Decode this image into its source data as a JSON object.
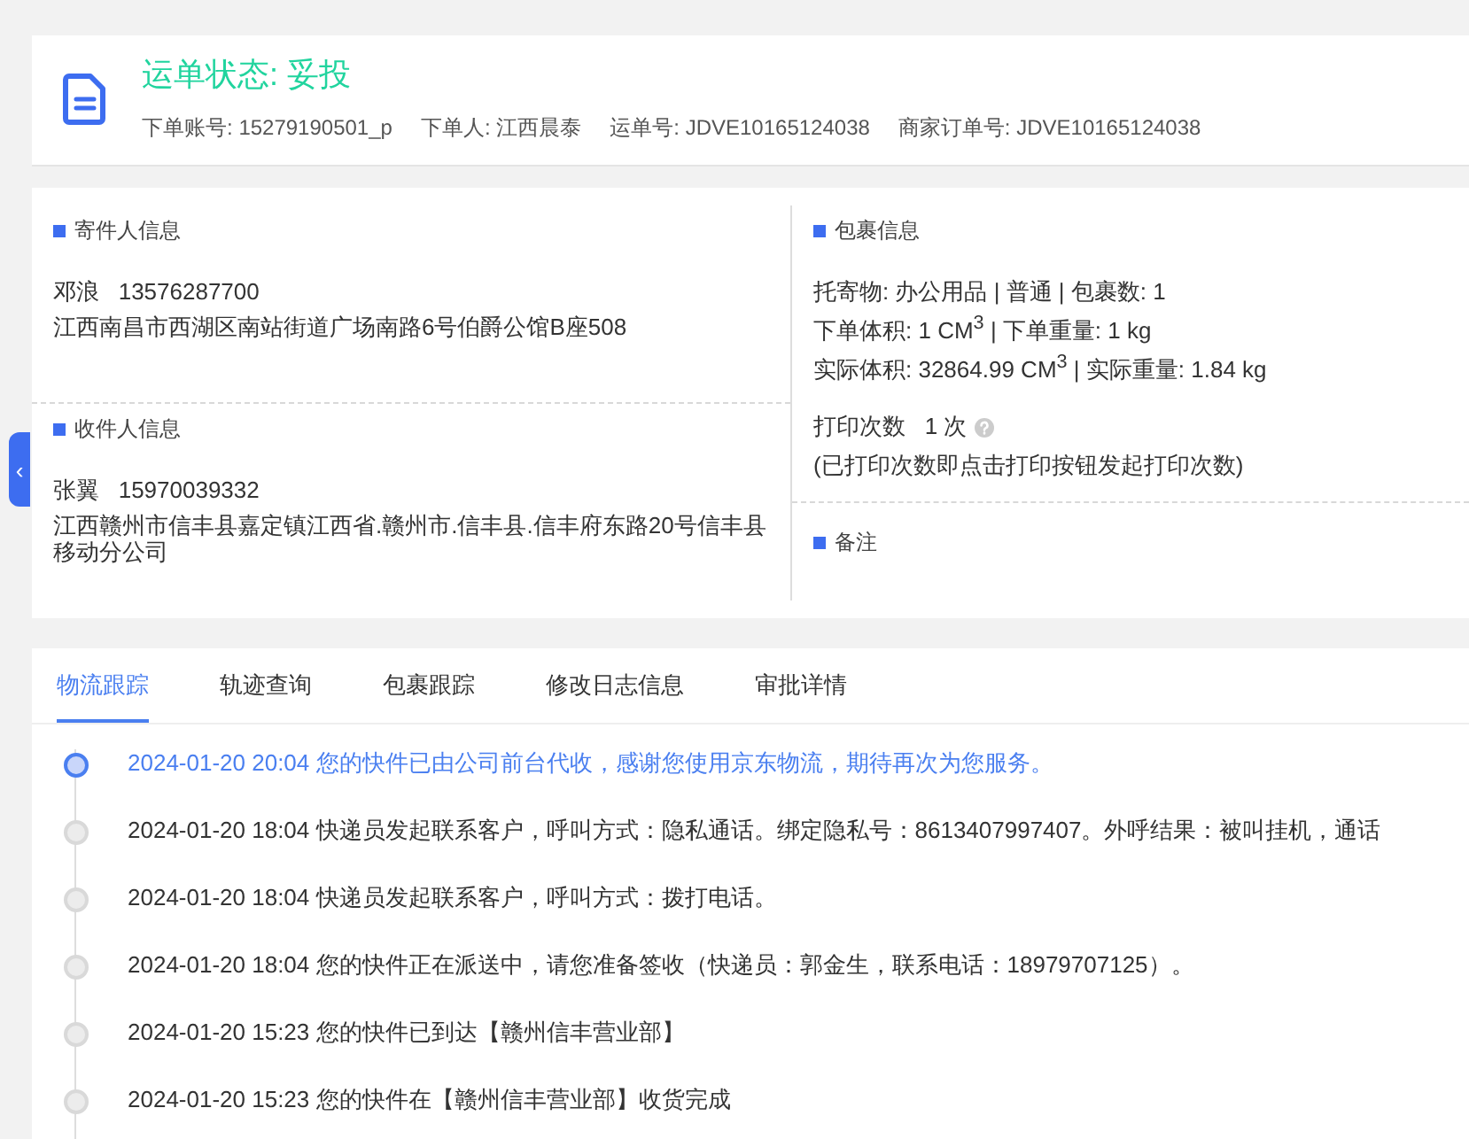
{
  "header": {
    "status": "运单状态: 妥投",
    "meta": [
      {
        "label": "下单账号:",
        "value": "15279190501_p"
      },
      {
        "label": "下单人:",
        "value": "江西晨泰"
      },
      {
        "label": "运单号:",
        "value": "JDVE10165124038"
      },
      {
        "label": "商家订单号:",
        "value": "JDVE10165124038"
      }
    ]
  },
  "sender": {
    "title": "寄件人信息",
    "name": "邓浪",
    "phone": "13576287700",
    "address": "江西南昌市西湖区南站街道广场南路6号伯爵公馆B座508"
  },
  "receiver": {
    "title": "收件人信息",
    "name": "张翼",
    "phone": "15970039332",
    "address": "江西赣州市信丰县嘉定镇江西省.赣州市.信丰县.信丰府东路20号信丰县移动分公司"
  },
  "package": {
    "title": "包裹信息",
    "lines": [
      "托寄物:  办公用品 | 普通  |  包裹数:  1",
      "下单体积:   1 CM$^{3}$ |  下单重量:  1 kg",
      "实际体积:   32864.99 CM$^{3}$ |  实际重量:  1.84 kg"
    ],
    "print_label": "打印次数",
    "print_count": "1 次",
    "print_note": "(已打印次数即点击打印按钮发起打印次数)"
  },
  "remarks": {
    "title": "备注"
  },
  "side_toggle": {
    "glyph": "‹"
  },
  "tabs": [
    {
      "label": "物流跟踪",
      "selected": true
    },
    {
      "label": "轨迹查询",
      "selected": false
    },
    {
      "label": "包裹跟踪",
      "selected": false
    },
    {
      "label": "修改日志信息",
      "selected": false
    },
    {
      "label": "审批详情",
      "selected": false
    }
  ],
  "timeline": [
    {
      "text": "2024-01-20 20:04 您的快件已由公司前台代收，感谢您使用京东物流，期待再次为您服务。",
      "current": true
    },
    {
      "text": "2024-01-20 18:04 快递员发起联系客户，呼叫方式：隐私通话。绑定隐私号：8613407997407。外呼结果：被叫挂机，通话",
      "current": false
    },
    {
      "text": "2024-01-20 18:04 快递员发起联系客户，呼叫方式：拨打电话。",
      "current": false
    },
    {
      "text": "2024-01-20 18:04 您的快件正在派送中，请您准备签收（快递员：郭金生，联系电话：18979707125）。",
      "current": false
    },
    {
      "text": "2024-01-20 15:23 您的快件已到达【赣州信丰营业部】",
      "current": false
    },
    {
      "text": "2024-01-20 15:23 您的快件在【赣州信丰营业部】收货完成",
      "current": false
    }
  ]
}
